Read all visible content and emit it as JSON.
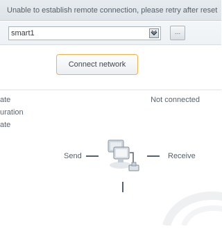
{
  "message_bar": {
    "text": "Unable to establish remote connection, please retry after reset"
  },
  "network_select": {
    "value": "smart1"
  },
  "more_button": {
    "label": "..."
  },
  "connect_button": {
    "label": "Connect network"
  },
  "properties": [
    {
      "label": "ate"
    },
    {
      "label": "uration"
    },
    {
      "label": "ate"
    }
  ],
  "status_value": "Not connected",
  "diagram": {
    "send_label": "Send",
    "receive_label": "Receive",
    "icon": "network-computers-icon"
  },
  "colors": {
    "message_bar_bg": "#e2e7eb",
    "connect_border": "#f0b24a",
    "text": "#5a646d"
  }
}
